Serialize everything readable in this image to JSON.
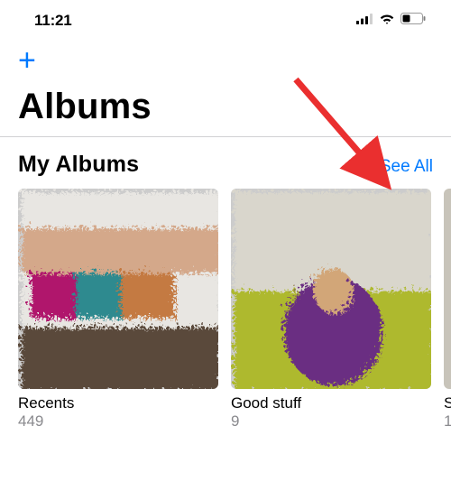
{
  "status": {
    "time": "11:21"
  },
  "nav": {
    "add_label": "+"
  },
  "page": {
    "title": "Albums"
  },
  "section": {
    "title": "My Albums",
    "see_all_label": "See All"
  },
  "albums": [
    {
      "title": "Recents",
      "count": "449"
    },
    {
      "title": "Good stuff",
      "count": "9"
    },
    {
      "title": "S",
      "count": "1"
    }
  ],
  "colors": {
    "accent": "#007aff",
    "arrow": "#ea2f2f"
  }
}
